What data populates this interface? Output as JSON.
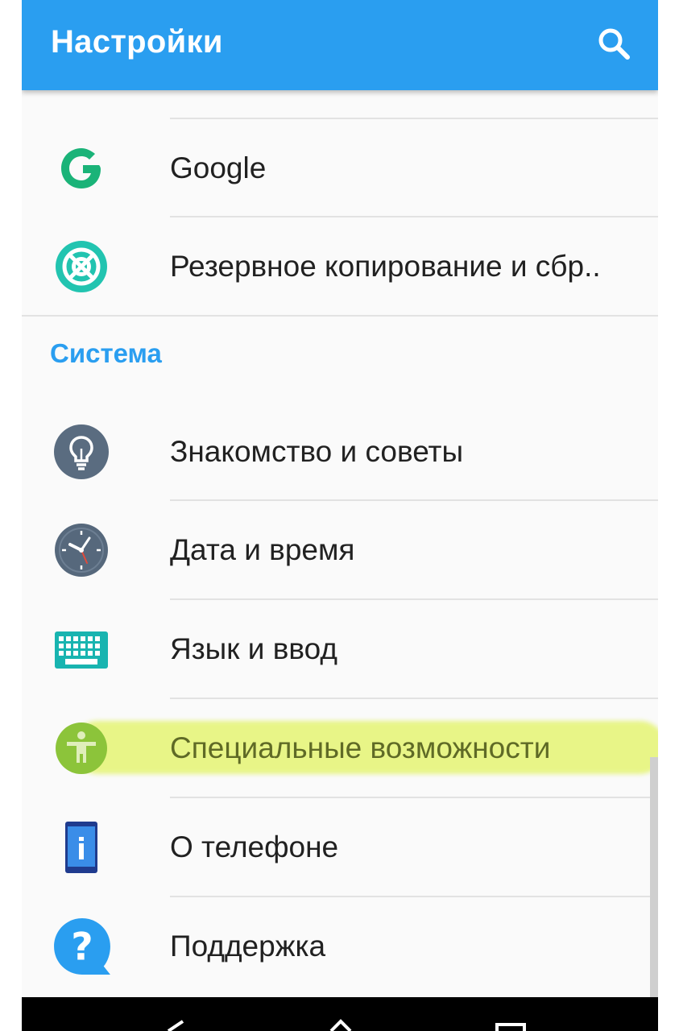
{
  "appbar": {
    "title": "Настройки",
    "search_icon": "search-icon"
  },
  "items_top": [
    {
      "label": "Google",
      "icon": "google-icon"
    },
    {
      "label": "Резервное копирование и сбр..",
      "icon": "backup-reset-icon"
    }
  ],
  "section": {
    "title": "Система"
  },
  "items_system": [
    {
      "label": "Знакомство и советы",
      "icon": "lightbulb-icon"
    },
    {
      "label": "Дата и время",
      "icon": "clock-icon"
    },
    {
      "label": "Язык и ввод",
      "icon": "keyboard-icon"
    },
    {
      "label": "Специальные возможности",
      "icon": "accessibility-icon",
      "highlighted": true
    },
    {
      "label": "О телефоне",
      "icon": "phone-info-icon"
    },
    {
      "label": "Поддержка",
      "icon": "help-icon"
    }
  ],
  "navbar": {
    "buttons": [
      "back-icon",
      "home-icon",
      "recents-icon"
    ]
  },
  "colors": {
    "accent": "#2a9ef0",
    "highlight": "#d8f028"
  }
}
